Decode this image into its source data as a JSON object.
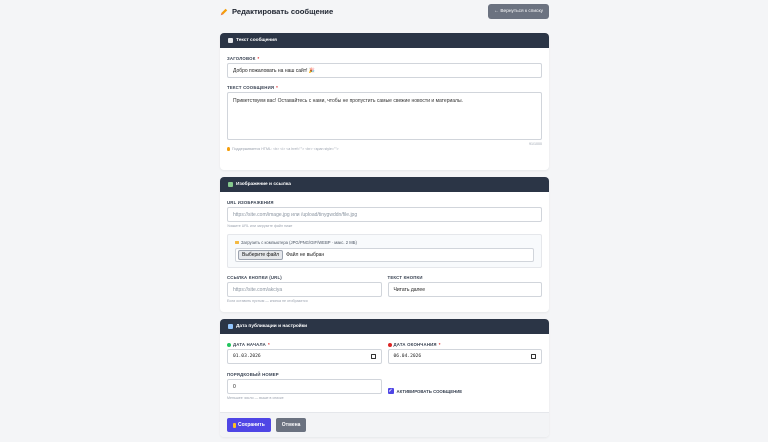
{
  "header": {
    "title": "Редактировать сообщение",
    "back_label": "← Вернуться к списку"
  },
  "section_text": {
    "title": "Текст сообщения",
    "title_label": "ЗАГОЛОВОК",
    "title_value": "Добро пожаловать на наш сайт! 🎉",
    "body_label": "ТЕКСТ СООБЩЕНИЯ",
    "body_value": "Приветствуем вас! Оставайтесь с нами, чтобы не пропустить самые свежие новости и материалы.",
    "counter": "91/1000",
    "html_hint": "Поддерживается HTML: <b> <i> <a href=\"\"> <br> <span style=\"\">"
  },
  "section_media": {
    "title": "Изображение и ссылка",
    "image_url_label": "URL ИЗОБРАЖЕНИЯ",
    "image_url_placeholder": "https://site.com/image.jpg или /upload/tinygwddn/file.jpg",
    "image_url_hint": "Укажите URL или загрузите файл ниже",
    "upload_label": "Загрузить с компьютера (JPG/PNG/GIF/WEBP · макс. 2 МБ)",
    "file_button": "Выберите файл",
    "file_status": "Файл не выбран",
    "button_url_label": "ССЫЛКА КНОПКИ (URL)",
    "button_url_placeholder": "https://site.com/akciya",
    "button_url_hint": "Если оставить пустым — кнопка не отобразится",
    "button_text_label": "ТЕКСТ КНОПКИ",
    "button_text_value": "Читать далее"
  },
  "section_dates": {
    "title": "Дата публикации и настройки",
    "start_label": "ДАТА НАЧАЛА",
    "start_value": "01.03.2026",
    "end_label": "ДАТА ОКОНЧАНИЯ",
    "end_value": "06.04.2026",
    "order_label": "ПОРЯДКОВЫЙ НОМЕР",
    "order_value": "0",
    "order_hint": "Меньшее число — выше в списке",
    "activate_label": "АКТИВИРОВАТЬ СООБЩЕНИЕ",
    "activate_checked": true
  },
  "actions": {
    "save_label": "Сохранить",
    "cancel_label": "Отмена"
  },
  "colors": {
    "header_bg": "#2b3546",
    "primary": "#4f46e5",
    "secondary": "#6b7280",
    "required": "#dc2626",
    "start_dot": "#22c55e",
    "end_dot": "#dc2626"
  },
  "icons": {
    "title": "pencil-icon",
    "section_text": "document-icon",
    "section_media": "image-icon",
    "section_dates": "calendar-icon",
    "hint": "lightbulb-icon",
    "upload": "folder-icon",
    "save": "save-icon"
  }
}
